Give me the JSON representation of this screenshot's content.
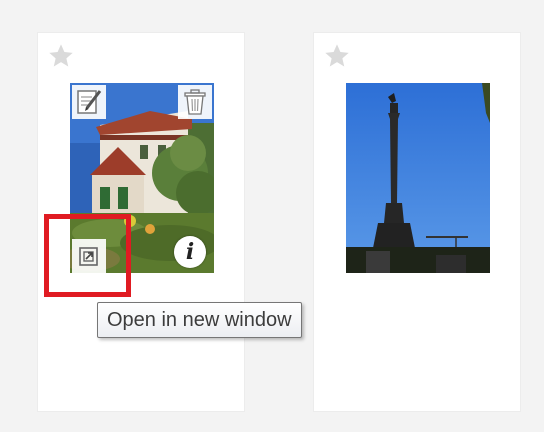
{
  "tooltip": {
    "text": "Open in new window"
  },
  "colors": {
    "highlight": "#e01b22",
    "star": "#d9d9d9",
    "card": "#ffffff",
    "background": "#f3f3f3"
  },
  "cards": [
    {
      "star": "star-icon",
      "photo": "house-photo",
      "actions": [
        "edit-icon",
        "trash-icon",
        "open-in-new-window-icon",
        "info-icon"
      ]
    },
    {
      "star": "star-icon",
      "photo": "column-monument-photo"
    }
  ]
}
